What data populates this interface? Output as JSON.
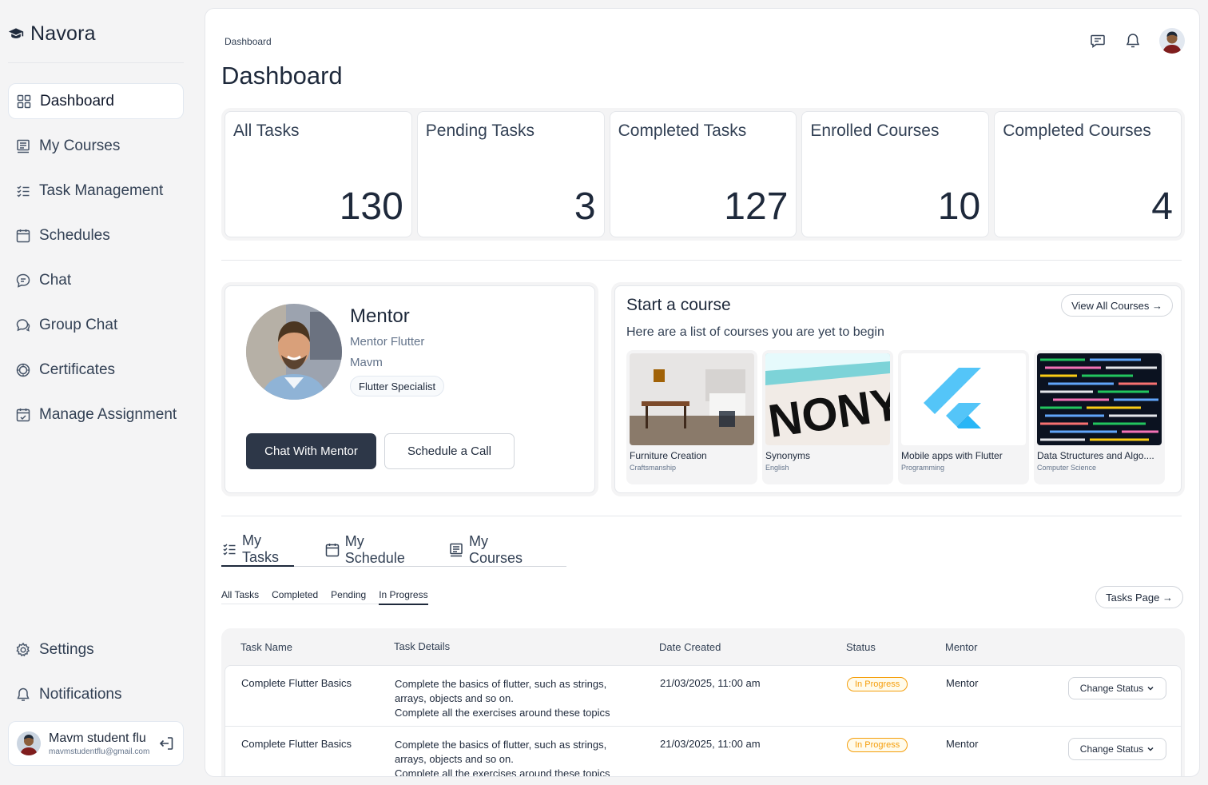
{
  "brand": {
    "name": "Navora"
  },
  "sidebar": {
    "items": [
      {
        "label": "Dashboard",
        "icon": "grid-icon",
        "active": true
      },
      {
        "label": "My Courses",
        "icon": "book-icon"
      },
      {
        "label": "Task Management",
        "icon": "checklist-icon"
      },
      {
        "label": "Schedules",
        "icon": "calendar-icon"
      },
      {
        "label": "Chat",
        "icon": "chat-icon"
      },
      {
        "label": "Group Chat",
        "icon": "group-chat-icon"
      },
      {
        "label": "Certificates",
        "icon": "certificate-icon"
      },
      {
        "label": "Manage Assignment",
        "icon": "calendar-edit-icon"
      }
    ],
    "bottom": [
      {
        "label": "Settings",
        "icon": "gear-icon"
      },
      {
        "label": "Notifications",
        "icon": "bell-icon"
      }
    ],
    "user": {
      "name": "Mavm student flu",
      "email": "mavmstudentflu@gmail.com"
    }
  },
  "header": {
    "breadcrumb": "Dashboard",
    "title": "Dashboard"
  },
  "stats": [
    {
      "label": "All Tasks",
      "value": "130"
    },
    {
      "label": "Pending Tasks",
      "value": "3"
    },
    {
      "label": "Completed Tasks",
      "value": "127"
    },
    {
      "label": "Enrolled Courses",
      "value": "10"
    },
    {
      "label": "Completed Courses",
      "value": "4"
    }
  ],
  "mentor": {
    "title": "Mentor",
    "subtitle": "Mentor Flutter",
    "name": "Mavm",
    "tag": "Flutter Specialist",
    "chat_button": "Chat With Mentor",
    "call_button": "Schedule a Call"
  },
  "courses": {
    "title": "Start a course",
    "subtitle": "Here are a list of courses you are yet to begin",
    "view_all": "View All Courses →",
    "items": [
      {
        "name": "Furniture Creation",
        "category": "Craftsmanship"
      },
      {
        "name": "Synonyms",
        "category": "English",
        "image_text": "NONY"
      },
      {
        "name": "Mobile apps with Flutter",
        "category": "Programming"
      },
      {
        "name": "Data Structures and Algo....",
        "category": "Computer Science"
      }
    ]
  },
  "tabs": [
    {
      "label": "My Tasks",
      "active": true
    },
    {
      "label": "My Schedule"
    },
    {
      "label": "My Courses"
    }
  ],
  "subtabs": [
    {
      "label": "All Tasks"
    },
    {
      "label": "Completed"
    },
    {
      "label": "Pending"
    },
    {
      "label": "In Progress",
      "active": true
    }
  ],
  "tasks_page": "Tasks Page →",
  "table": {
    "columns": [
      "Task Name",
      "Task Details",
      "Date Created",
      "Status",
      "Mentor"
    ],
    "rows": [
      {
        "name": "Complete Flutter Basics",
        "details": [
          "Complete the basics of flutter, such as strings,",
          "arrays, objects and so on.",
          "Complete all the exercises around these topics"
        ],
        "date": "21/03/2025, 11:00 am",
        "status": "In Progress",
        "mentor": "Mentor",
        "action": "Change Status"
      },
      {
        "name": "Complete Flutter Basics",
        "details": [
          "Complete the basics of flutter, such as strings,",
          "arrays, objects and so on.",
          "Complete all the exercises around these topics"
        ],
        "date": "21/03/2025, 11:00 am",
        "status": "In Progress",
        "mentor": "Mentor",
        "action": "Change Status"
      }
    ]
  },
  "colors": {
    "primary_dark": "#2d3748",
    "status_in_progress": "#f59e0b",
    "background": "#f4f4f5"
  }
}
